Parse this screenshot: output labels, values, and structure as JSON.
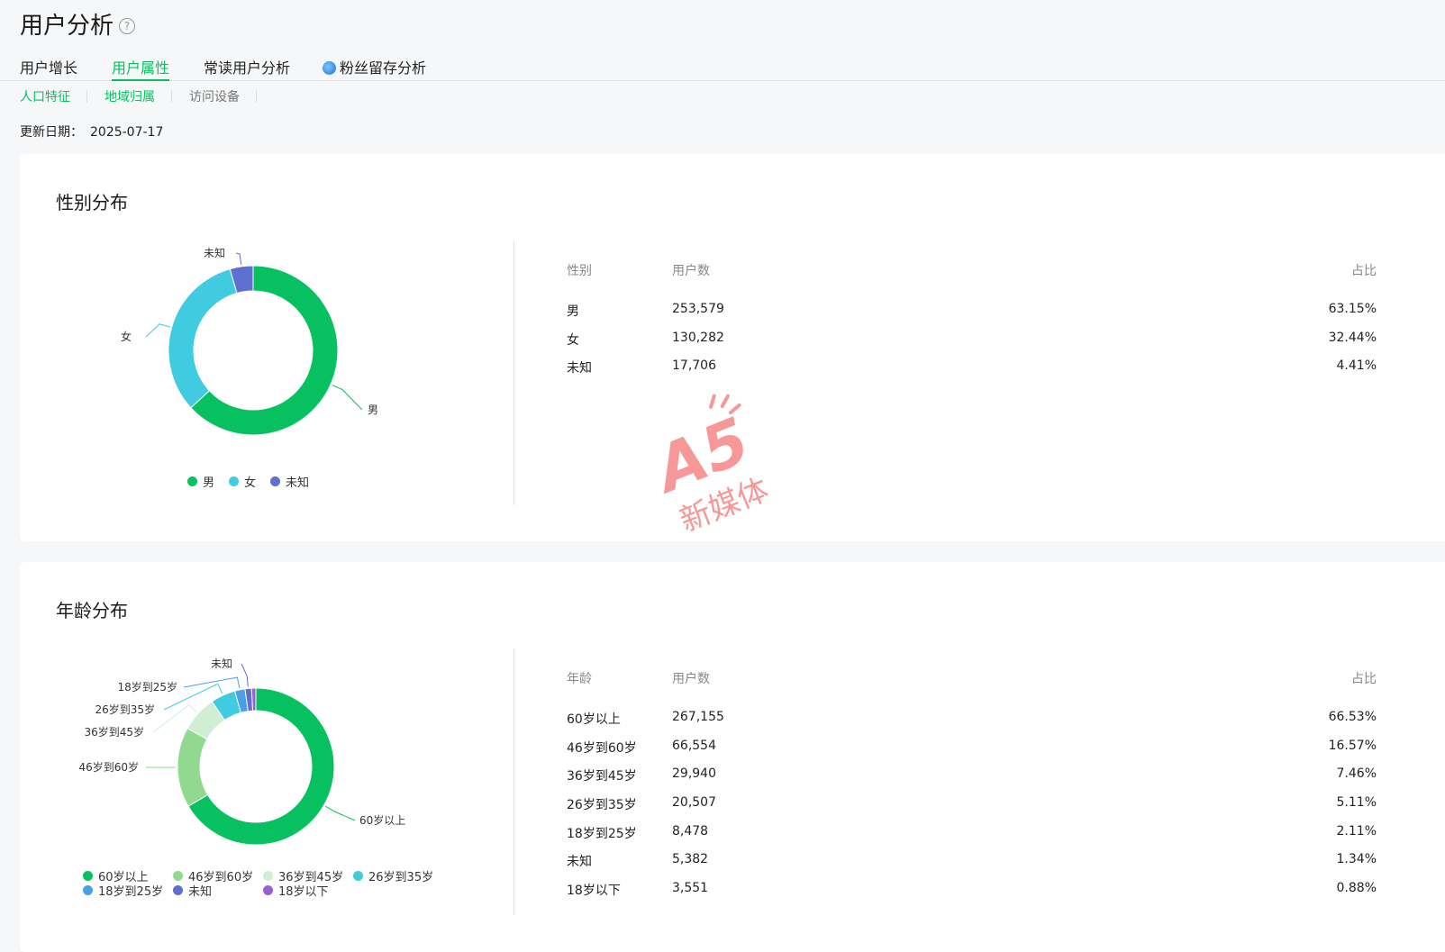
{
  "page": {
    "title": "用户分析",
    "help_glyph": "?"
  },
  "tabs": [
    {
      "label": "用户增长"
    },
    {
      "label": "用户属性"
    },
    {
      "label": "常读用户分析"
    },
    {
      "label": "粉丝留存分析"
    }
  ],
  "subtabs": [
    {
      "label": "人口特征"
    },
    {
      "label": "地域归属"
    },
    {
      "label": "访问设备"
    }
  ],
  "update": {
    "label": "更新日期：",
    "date": "2025-07-17"
  },
  "gender": {
    "title": "性别分布",
    "headers": {
      "c1": "性别",
      "c2": "用户数",
      "c3": "占比"
    },
    "rows": [
      {
        "name": "男",
        "count": "253,579",
        "pct": "63.15%"
      },
      {
        "name": "女",
        "count": "130,282",
        "pct": "32.44%"
      },
      {
        "name": "未知",
        "count": "17,706",
        "pct": "4.41%"
      }
    ]
  },
  "age": {
    "title": "年龄分布",
    "headers": {
      "c1": "年龄",
      "c2": "用户数",
      "c3": "占比"
    },
    "rows": [
      {
        "name": "60岁以上",
        "count": "267,155",
        "pct": "66.53%"
      },
      {
        "name": "46岁到60岁",
        "count": "66,554",
        "pct": "16.57%"
      },
      {
        "name": "36岁到45岁",
        "count": "29,940",
        "pct": "7.46%"
      },
      {
        "name": "26岁到35岁",
        "count": "20,507",
        "pct": "5.11%"
      },
      {
        "name": "18岁到25岁",
        "count": "8,478",
        "pct": "2.11%"
      },
      {
        "name": "未知",
        "count": "5,382",
        "pct": "1.34%"
      },
      {
        "name": "18岁以下",
        "count": "3,551",
        "pct": "0.88%"
      }
    ]
  },
  "chart_data": [
    {
      "type": "pie",
      "title": "性别分布",
      "categories": [
        "男",
        "女",
        "未知"
      ],
      "values": [
        63.15,
        32.44,
        4.41
      ],
      "colors": [
        "#07c160",
        "#40cbe0",
        "#5f6fcf"
      ],
      "legend": "bottom"
    },
    {
      "type": "pie",
      "title": "年龄分布",
      "categories": [
        "60岁以上",
        "46岁到60岁",
        "36岁到45岁",
        "26岁到35岁",
        "18岁到25岁",
        "未知",
        "18岁以下"
      ],
      "values": [
        66.53,
        16.57,
        7.46,
        5.11,
        2.11,
        1.34,
        0.88
      ],
      "colors": [
        "#07c160",
        "#91d98f",
        "#cfeed3",
        "#40cbe0",
        "#4a9fe8",
        "#5f6fcf",
        "#9660d0"
      ],
      "legend": "bottom"
    }
  ],
  "watermark": {
    "logo": "A5",
    "text": "新媒体"
  }
}
